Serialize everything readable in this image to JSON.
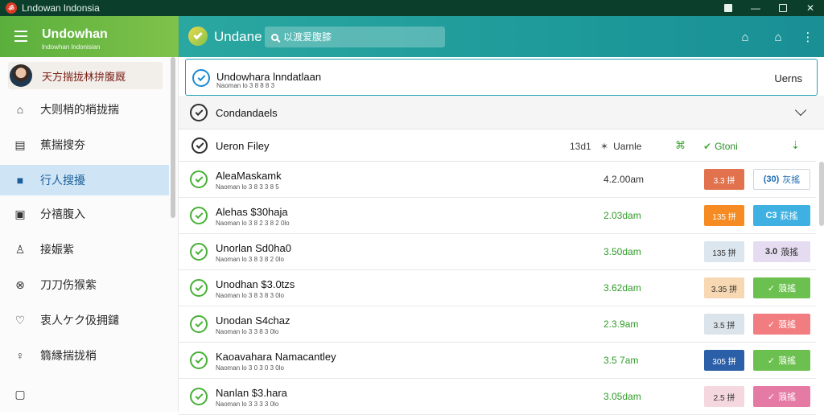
{
  "window": {
    "title": "Lndowan lndonsia",
    "app_icon_glyph": "ॐ"
  },
  "left_header": {
    "brand": "Undowhan",
    "subtitle": "lndowhan lndonisian"
  },
  "main_header": {
    "app_name": "Undane",
    "search_placeholder": "以渡爱腹膝"
  },
  "sidebar": {
    "profile_name": "天方揣拢林拚腹厩",
    "items": [
      {
        "label": "大则梢的梢拢揣",
        "icon": "home-icon"
      },
      {
        "label": "蕉揣搜夯",
        "icon": "list-icon"
      },
      {
        "label": "行人搜擾",
        "icon": "folder-icon",
        "active": true
      },
      {
        "label": "分禧腹入",
        "icon": "square-icon"
      },
      {
        "label": "接娠紫",
        "icon": "person-icon"
      },
      {
        "label": "刀刀伤猴紫",
        "icon": "close-circle-icon"
      },
      {
        "label": "衷人ケク伋拥鑓",
        "icon": "chat-icon"
      },
      {
        "label": "篛縁揣拢梢",
        "icon": "user-icon"
      },
      {
        "label": "",
        "icon": "camera-icon"
      }
    ]
  },
  "selected": {
    "title": "Undowhara lnndatlaan",
    "subtitle": "Naoman lo 3 8 8 8 3",
    "right": "Uerns"
  },
  "group": {
    "title": "Condandaels"
  },
  "columns": {
    "name": "Ueron Filey",
    "c1": "13d1",
    "c2_icon": "✶",
    "c2": "Uarnle",
    "c3": "⌘",
    "c4_icon": "✔",
    "c4": "Gtoni",
    "c5": "⇣"
  },
  "rows": [
    {
      "title": "AleaMaskamk",
      "sub": "Naoman lo 3 8 3 3 8 5",
      "time": "4.2.00am",
      "time_green": false,
      "badge": "3.3 拼",
      "badge_bg": "#e2724d",
      "badge_fg": "#ffffff",
      "btn_icon": "(30)",
      "btn": "灰搖",
      "btn_bg": "#ffffff",
      "btn_fg": "#1e6db3",
      "btn_border": "#cfd6dc"
    },
    {
      "title": "Alehas $30haja",
      "sub": "Naoman lo 3 8 2 3 8 2 0lo",
      "time": "2.03dam",
      "time_green": true,
      "badge": "135 拼",
      "badge_bg": "#f58b22",
      "badge_fg": "#ffffff",
      "btn_icon": "C3",
      "btn": "荻搖",
      "btn_bg": "#3eb1e2",
      "btn_fg": "#ffffff",
      "btn_border": "#3eb1e2"
    },
    {
      "title": "Unorlan Sd0ha0",
      "sub": "Naoman lo 3 8 3 8 2 0lo",
      "time": "3.50dam",
      "time_green": true,
      "badge": "135 拼",
      "badge_bg": "#dbe6ee",
      "badge_fg": "#333333",
      "btn_icon": "3.0",
      "btn": "蒗搖",
      "btn_bg": "#e6dcf2",
      "btn_fg": "#333333",
      "btn_border": "#e6dcf2"
    },
    {
      "title": "Unodhan $3.0tzs",
      "sub": "Naoman lo 3 8 3 8 3 0lo",
      "time": "3.62dam",
      "time_green": true,
      "badge": "3.35 拼",
      "badge_bg": "#f7d8b2",
      "badge_fg": "#333333",
      "btn_icon": "✓",
      "btn": "蒗搖",
      "btn_bg": "#6cc04f",
      "btn_fg": "#ffffff",
      "btn_border": "#6cc04f"
    },
    {
      "title": "Unodan S4chaz",
      "sub": "Naoman lo 3 3 8 3 0lo",
      "time": "2.3.9am",
      "time_green": true,
      "badge": "3.5 拼",
      "badge_bg": "#dbe4ea",
      "badge_fg": "#333333",
      "btn_icon": "✓",
      "btn": "蒗搖",
      "btn_bg": "#f17d80",
      "btn_fg": "#ffffff",
      "btn_border": "#f17d80"
    },
    {
      "title": "Kaoavahara Namacantley",
      "sub": "Naoman lo 3 0 3 0 3 0lo",
      "time": "3.5 7am",
      "time_green": true,
      "badge": "305 拼",
      "badge_bg": "#2b5fa8",
      "badge_fg": "#ffffff",
      "btn_icon": "✓",
      "btn": "蒗搖",
      "btn_bg": "#6cc04f",
      "btn_fg": "#ffffff",
      "btn_border": "#6cc04f"
    },
    {
      "title": "Nanlan $3.hara",
      "sub": "Naoman lo 3 3 3 3 0lo",
      "time": "3.05dam",
      "time_green": true,
      "badge": "2.5 拼",
      "badge_bg": "#f5d7df",
      "badge_fg": "#333333",
      "btn_icon": "✓",
      "btn": "蒗搖",
      "btn_bg": "#e57aa5",
      "btn_fg": "#ffffff",
      "btn_border": "#e57aa5"
    }
  ]
}
